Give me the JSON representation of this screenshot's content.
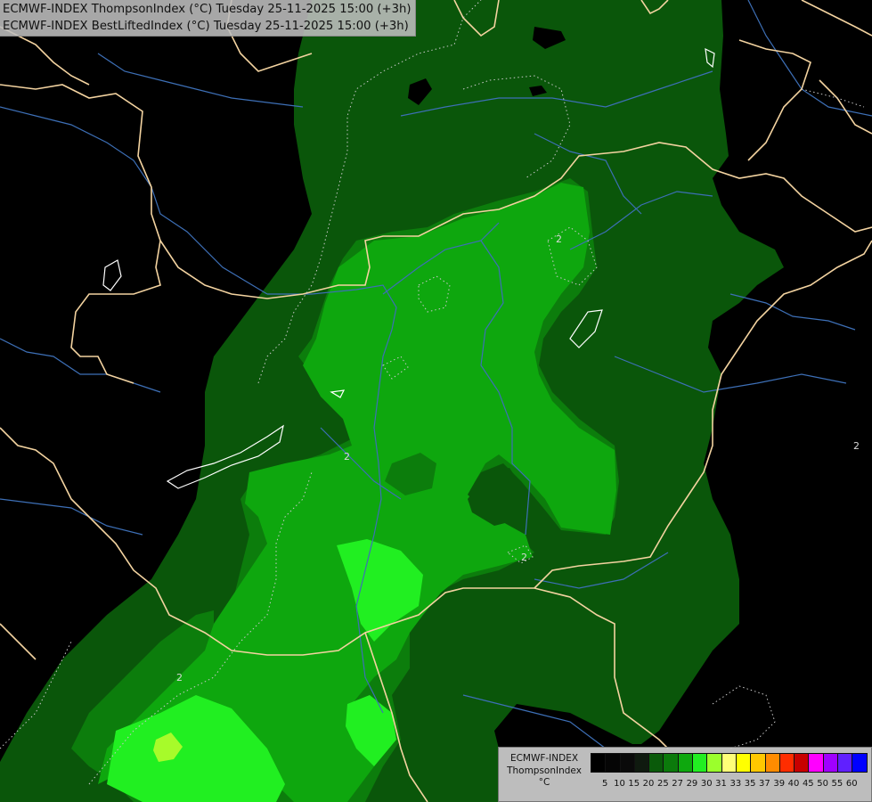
{
  "header": {
    "line1": "ECMWF-INDEX ThompsonIndex (°C) Tuesday 25-11-2025 15:00 (+3h)",
    "line2": "ECMWF-INDEX BestLiftedIndex (°C) Tuesday 25-11-2025 15:00 (+3h)"
  },
  "legend": {
    "line1": "ECMWF-INDEX",
    "line2": "ThompsonIndex",
    "line3": "°C",
    "ticks": [
      "5",
      "10",
      "15",
      "20",
      "25",
      "27",
      "29",
      "30",
      "31",
      "33",
      "35",
      "37",
      "39",
      "40",
      "45",
      "50",
      "55",
      "60"
    ],
    "colors": [
      "#000000",
      "#050505",
      "#0a0a0a",
      "#0f1a0f",
      "#0a5a0a",
      "#0b7a0b",
      "#0ea80e",
      "#22ee22",
      "#9bff2c",
      "#ffff78",
      "#ffff00",
      "#ffc800",
      "#ff8c00",
      "#ff2d00",
      "#c80000",
      "#ff00ff",
      "#a000ff",
      "#6020ff",
      "#0000ff"
    ]
  },
  "contour_labels": [
    "2",
    "2",
    "2",
    "2",
    "2"
  ],
  "map_colors": {
    "background": "#000000",
    "level1": "#0a560a",
    "level2": "#0c7d0c",
    "level3": "#0ea70e",
    "level4": "#21ef21",
    "level5": "#a7fb2a",
    "border": "#f3d3a0",
    "river": "#3d6fb6",
    "contour": "#c9c9c9"
  }
}
